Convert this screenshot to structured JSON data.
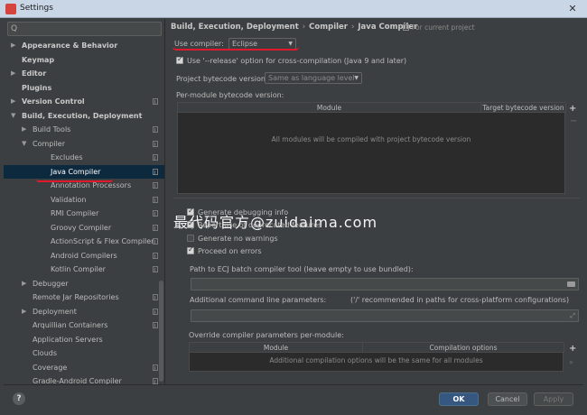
{
  "window": {
    "title": "Settings"
  },
  "search": {
    "placeholder": ""
  },
  "tree": [
    {
      "label": "Appearance & Behavior",
      "indent": 0,
      "arrow": "▶",
      "bold": true,
      "copy": false
    },
    {
      "label": "Keymap",
      "indent": 0,
      "arrow": "",
      "bold": true,
      "copy": false
    },
    {
      "label": "Editor",
      "indent": 0,
      "arrow": "▶",
      "bold": true,
      "copy": false
    },
    {
      "label": "Plugins",
      "indent": 0,
      "arrow": "",
      "bold": true,
      "copy": false
    },
    {
      "label": "Version Control",
      "indent": 0,
      "arrow": "▶",
      "bold": true,
      "copy": true
    },
    {
      "label": "Build, Execution, Deployment",
      "indent": 0,
      "arrow": "▼",
      "bold": true,
      "copy": false
    },
    {
      "label": "Build Tools",
      "indent": 1,
      "arrow": "▶",
      "bold": false,
      "copy": true
    },
    {
      "label": "Compiler",
      "indent": 1,
      "arrow": "▼",
      "bold": false,
      "copy": true
    },
    {
      "label": "Excludes",
      "indent": 2,
      "arrow": "",
      "bold": false,
      "copy": true
    },
    {
      "label": "Java Compiler",
      "indent": 2,
      "arrow": "",
      "bold": false,
      "copy": true,
      "selected": true
    },
    {
      "label": "Annotation Processors",
      "indent": 2,
      "arrow": "",
      "bold": false,
      "copy": true
    },
    {
      "label": "Validation",
      "indent": 2,
      "arrow": "",
      "bold": false,
      "copy": true
    },
    {
      "label": "RMI Compiler",
      "indent": 2,
      "arrow": "",
      "bold": false,
      "copy": true
    },
    {
      "label": "Groovy Compiler",
      "indent": 2,
      "arrow": "",
      "bold": false,
      "copy": true
    },
    {
      "label": "ActionScript & Flex Compiler",
      "indent": 2,
      "arrow": "",
      "bold": false,
      "copy": true
    },
    {
      "label": "Android Compilers",
      "indent": 2,
      "arrow": "",
      "bold": false,
      "copy": true
    },
    {
      "label": "Kotlin Compiler",
      "indent": 2,
      "arrow": "",
      "bold": false,
      "copy": true
    },
    {
      "label": "Debugger",
      "indent": 1,
      "arrow": "▶",
      "bold": false,
      "copy": false
    },
    {
      "label": "Remote Jar Repositories",
      "indent": 1,
      "arrow": "",
      "bold": false,
      "copy": true
    },
    {
      "label": "Deployment",
      "indent": 1,
      "arrow": "▶",
      "bold": false,
      "copy": true
    },
    {
      "label": "Arquillian Containers",
      "indent": 1,
      "arrow": "",
      "bold": false,
      "copy": true
    },
    {
      "label": "Application Servers",
      "indent": 1,
      "arrow": "",
      "bold": false,
      "copy": false
    },
    {
      "label": "Clouds",
      "indent": 1,
      "arrow": "",
      "bold": false,
      "copy": false
    },
    {
      "label": "Coverage",
      "indent": 1,
      "arrow": "",
      "bold": false,
      "copy": true
    },
    {
      "label": "Gradle-Android Compiler",
      "indent": 1,
      "arrow": "",
      "bold": false,
      "copy": true
    }
  ],
  "breadcrumb": {
    "part1": "Build, Execution, Deployment",
    "sep": "›",
    "part2": "Compiler",
    "part3": "Java Compiler"
  },
  "for_project": "For current project",
  "compiler": {
    "label": "Use compiler:",
    "value": "Eclipse"
  },
  "release_option": {
    "label": "Use '--release' option for cross-compilation (Java 9 and later)",
    "checked": true
  },
  "bytecode": {
    "label": "Project bytecode version:",
    "value": "Same as language level"
  },
  "per_module": {
    "label": "Per-module bytecode version:",
    "col_module": "Module",
    "col_target": "Target bytecode version",
    "empty": "All modules will be compiled with project bytecode version"
  },
  "watermark": "最代码官方@zuidaima.com",
  "options": [
    {
      "label": "Generate debugging info",
      "checked": true
    },
    {
      "label": "Report use of deprecated features",
      "checked": true
    },
    {
      "label": "Generate no warnings",
      "checked": false
    },
    {
      "label": "Proceed on errors",
      "checked": true
    }
  ],
  "ecj_path": {
    "label": "Path to ECJ batch compiler tool (leave empty to use bundled):",
    "value": ""
  },
  "cmd_params": {
    "label": "Additional command line parameters:",
    "hint": "('/' recommended in paths for cross-platform configurations)",
    "value": ""
  },
  "override": {
    "label": "Override compiler parameters per-module:",
    "col_module": "Module",
    "col_options": "Compilation options",
    "empty": "Additional compilation options will be the same for all modules"
  },
  "buttons": {
    "help": "?",
    "ok": "OK",
    "cancel": "Cancel",
    "apply": "Apply"
  },
  "icons": {
    "plus": "+",
    "minus": "−",
    "chevron": "▼",
    "search": "Q",
    "close": "✕",
    "double_chevron": "»"
  }
}
